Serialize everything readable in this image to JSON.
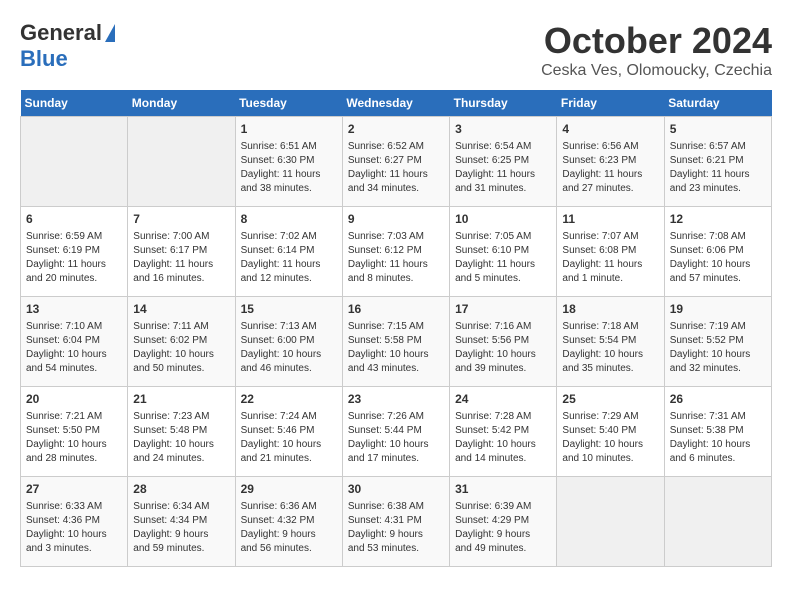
{
  "logo": {
    "general": "General",
    "blue": "Blue"
  },
  "title": {
    "month": "October 2024",
    "location": "Ceska Ves, Olomoucky, Czechia"
  },
  "headers": [
    "Sunday",
    "Monday",
    "Tuesday",
    "Wednesday",
    "Thursday",
    "Friday",
    "Saturday"
  ],
  "weeks": [
    [
      {
        "day": "",
        "info": ""
      },
      {
        "day": "",
        "info": ""
      },
      {
        "day": "1",
        "info": "Sunrise: 6:51 AM\nSunset: 6:30 PM\nDaylight: 11 hours\nand 38 minutes."
      },
      {
        "day": "2",
        "info": "Sunrise: 6:52 AM\nSunset: 6:27 PM\nDaylight: 11 hours\nand 34 minutes."
      },
      {
        "day": "3",
        "info": "Sunrise: 6:54 AM\nSunset: 6:25 PM\nDaylight: 11 hours\nand 31 minutes."
      },
      {
        "day": "4",
        "info": "Sunrise: 6:56 AM\nSunset: 6:23 PM\nDaylight: 11 hours\nand 27 minutes."
      },
      {
        "day": "5",
        "info": "Sunrise: 6:57 AM\nSunset: 6:21 PM\nDaylight: 11 hours\nand 23 minutes."
      }
    ],
    [
      {
        "day": "6",
        "info": "Sunrise: 6:59 AM\nSunset: 6:19 PM\nDaylight: 11 hours\nand 20 minutes."
      },
      {
        "day": "7",
        "info": "Sunrise: 7:00 AM\nSunset: 6:17 PM\nDaylight: 11 hours\nand 16 minutes."
      },
      {
        "day": "8",
        "info": "Sunrise: 7:02 AM\nSunset: 6:14 PM\nDaylight: 11 hours\nand 12 minutes."
      },
      {
        "day": "9",
        "info": "Sunrise: 7:03 AM\nSunset: 6:12 PM\nDaylight: 11 hours\nand 8 minutes."
      },
      {
        "day": "10",
        "info": "Sunrise: 7:05 AM\nSunset: 6:10 PM\nDaylight: 11 hours\nand 5 minutes."
      },
      {
        "day": "11",
        "info": "Sunrise: 7:07 AM\nSunset: 6:08 PM\nDaylight: 11 hours\nand 1 minute."
      },
      {
        "day": "12",
        "info": "Sunrise: 7:08 AM\nSunset: 6:06 PM\nDaylight: 10 hours\nand 57 minutes."
      }
    ],
    [
      {
        "day": "13",
        "info": "Sunrise: 7:10 AM\nSunset: 6:04 PM\nDaylight: 10 hours\nand 54 minutes."
      },
      {
        "day": "14",
        "info": "Sunrise: 7:11 AM\nSunset: 6:02 PM\nDaylight: 10 hours\nand 50 minutes."
      },
      {
        "day": "15",
        "info": "Sunrise: 7:13 AM\nSunset: 6:00 PM\nDaylight: 10 hours\nand 46 minutes."
      },
      {
        "day": "16",
        "info": "Sunrise: 7:15 AM\nSunset: 5:58 PM\nDaylight: 10 hours\nand 43 minutes."
      },
      {
        "day": "17",
        "info": "Sunrise: 7:16 AM\nSunset: 5:56 PM\nDaylight: 10 hours\nand 39 minutes."
      },
      {
        "day": "18",
        "info": "Sunrise: 7:18 AM\nSunset: 5:54 PM\nDaylight: 10 hours\nand 35 minutes."
      },
      {
        "day": "19",
        "info": "Sunrise: 7:19 AM\nSunset: 5:52 PM\nDaylight: 10 hours\nand 32 minutes."
      }
    ],
    [
      {
        "day": "20",
        "info": "Sunrise: 7:21 AM\nSunset: 5:50 PM\nDaylight: 10 hours\nand 28 minutes."
      },
      {
        "day": "21",
        "info": "Sunrise: 7:23 AM\nSunset: 5:48 PM\nDaylight: 10 hours\nand 24 minutes."
      },
      {
        "day": "22",
        "info": "Sunrise: 7:24 AM\nSunset: 5:46 PM\nDaylight: 10 hours\nand 21 minutes."
      },
      {
        "day": "23",
        "info": "Sunrise: 7:26 AM\nSunset: 5:44 PM\nDaylight: 10 hours\nand 17 minutes."
      },
      {
        "day": "24",
        "info": "Sunrise: 7:28 AM\nSunset: 5:42 PM\nDaylight: 10 hours\nand 14 minutes."
      },
      {
        "day": "25",
        "info": "Sunrise: 7:29 AM\nSunset: 5:40 PM\nDaylight: 10 hours\nand 10 minutes."
      },
      {
        "day": "26",
        "info": "Sunrise: 7:31 AM\nSunset: 5:38 PM\nDaylight: 10 hours\nand 6 minutes."
      }
    ],
    [
      {
        "day": "27",
        "info": "Sunrise: 6:33 AM\nSunset: 4:36 PM\nDaylight: 10 hours\nand 3 minutes."
      },
      {
        "day": "28",
        "info": "Sunrise: 6:34 AM\nSunset: 4:34 PM\nDaylight: 9 hours\nand 59 minutes."
      },
      {
        "day": "29",
        "info": "Sunrise: 6:36 AM\nSunset: 4:32 PM\nDaylight: 9 hours\nand 56 minutes."
      },
      {
        "day": "30",
        "info": "Sunrise: 6:38 AM\nSunset: 4:31 PM\nDaylight: 9 hours\nand 53 minutes."
      },
      {
        "day": "31",
        "info": "Sunrise: 6:39 AM\nSunset: 4:29 PM\nDaylight: 9 hours\nand 49 minutes."
      },
      {
        "day": "",
        "info": ""
      },
      {
        "day": "",
        "info": ""
      }
    ]
  ]
}
